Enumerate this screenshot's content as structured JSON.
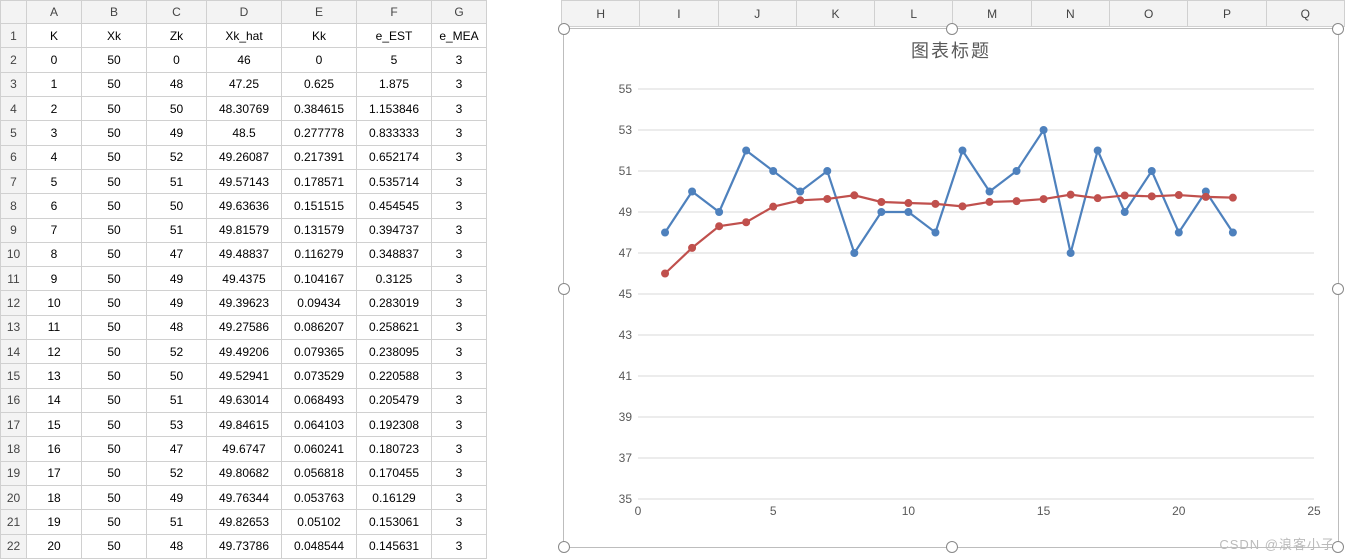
{
  "watermark": "CSDN @浪客小子",
  "columns": [
    "A",
    "B",
    "C",
    "D",
    "E",
    "F",
    "G",
    "H",
    "I",
    "J",
    "K",
    "L",
    "M",
    "N",
    "O",
    "P",
    "Q"
  ],
  "header_row": [
    "K",
    "Xk",
    "Zk",
    "Xk_hat",
    "Kk",
    "e_EST",
    "e_MEA"
  ],
  "rows": [
    {
      "r": "2",
      "A": "0",
      "B": "50",
      "C": "0",
      "D": "46",
      "E": "0",
      "F": "5",
      "G": "3"
    },
    {
      "r": "3",
      "A": "1",
      "B": "50",
      "C": "48",
      "D": "47.25",
      "E": "0.625",
      "F": "1.875",
      "G": "3"
    },
    {
      "r": "4",
      "A": "2",
      "B": "50",
      "C": "50",
      "D": "48.30769",
      "E": "0.384615",
      "F": "1.153846",
      "G": "3"
    },
    {
      "r": "5",
      "A": "3",
      "B": "50",
      "C": "49",
      "D": "48.5",
      "E": "0.277778",
      "F": "0.833333",
      "G": "3"
    },
    {
      "r": "6",
      "A": "4",
      "B": "50",
      "C": "52",
      "D": "49.26087",
      "E": "0.217391",
      "F": "0.652174",
      "G": "3"
    },
    {
      "r": "7",
      "A": "5",
      "B": "50",
      "C": "51",
      "D": "49.57143",
      "E": "0.178571",
      "F": "0.535714",
      "G": "3"
    },
    {
      "r": "8",
      "A": "6",
      "B": "50",
      "C": "50",
      "D": "49.63636",
      "E": "0.151515",
      "F": "0.454545",
      "G": "3"
    },
    {
      "r": "9",
      "A": "7",
      "B": "50",
      "C": "51",
      "D": "49.81579",
      "E": "0.131579",
      "F": "0.394737",
      "G": "3"
    },
    {
      "r": "10",
      "A": "8",
      "B": "50",
      "C": "47",
      "D": "49.48837",
      "E": "0.116279",
      "F": "0.348837",
      "G": "3"
    },
    {
      "r": "11",
      "A": "9",
      "B": "50",
      "C": "49",
      "D": "49.4375",
      "E": "0.104167",
      "F": "0.3125",
      "G": "3"
    },
    {
      "r": "12",
      "A": "10",
      "B": "50",
      "C": "49",
      "D": "49.39623",
      "E": "0.09434",
      "F": "0.283019",
      "G": "3"
    },
    {
      "r": "13",
      "A": "11",
      "B": "50",
      "C": "48",
      "D": "49.27586",
      "E": "0.086207",
      "F": "0.258621",
      "G": "3"
    },
    {
      "r": "14",
      "A": "12",
      "B": "50",
      "C": "52",
      "D": "49.49206",
      "E": "0.079365",
      "F": "0.238095",
      "G": "3"
    },
    {
      "r": "15",
      "A": "13",
      "B": "50",
      "C": "50",
      "D": "49.52941",
      "E": "0.073529",
      "F": "0.220588",
      "G": "3"
    },
    {
      "r": "16",
      "A": "14",
      "B": "50",
      "C": "51",
      "D": "49.63014",
      "E": "0.068493",
      "F": "0.205479",
      "G": "3"
    },
    {
      "r": "17",
      "A": "15",
      "B": "50",
      "C": "53",
      "D": "49.84615",
      "E": "0.064103",
      "F": "0.192308",
      "G": "3"
    },
    {
      "r": "18",
      "A": "16",
      "B": "50",
      "C": "47",
      "D": "49.6747",
      "E": "0.060241",
      "F": "0.180723",
      "G": "3"
    },
    {
      "r": "19",
      "A": "17",
      "B": "50",
      "C": "52",
      "D": "49.80682",
      "E": "0.056818",
      "F": "0.170455",
      "G": "3"
    },
    {
      "r": "20",
      "A": "18",
      "B": "50",
      "C": "49",
      "D": "49.76344",
      "E": "0.053763",
      "F": "0.16129",
      "G": "3"
    },
    {
      "r": "21",
      "A": "19",
      "B": "50",
      "C": "51",
      "D": "49.82653",
      "E": "0.05102",
      "F": "0.153061",
      "G": "3"
    },
    {
      "r": "22",
      "A": "20",
      "B": "50",
      "C": "48",
      "D": "49.73786",
      "E": "0.048544",
      "F": "0.145631",
      "G": "3"
    }
  ],
  "chart": {
    "title": "图表标题",
    "ylim": [
      35,
      55
    ],
    "yticks": [
      35,
      37,
      39,
      41,
      43,
      45,
      47,
      49,
      51,
      53,
      55
    ],
    "xlim": [
      0,
      25
    ],
    "xticks": [
      0,
      5,
      10,
      15,
      20,
      25
    ],
    "colors": {
      "blue": "#4e81bd",
      "red": "#c0504d"
    }
  },
  "chart_data": {
    "type": "line",
    "title": "图表标题",
    "xlabel": "",
    "ylabel": "",
    "xlim": [
      0,
      25
    ],
    "ylim": [
      35,
      55
    ],
    "x": [
      1,
      2,
      3,
      4,
      5,
      6,
      7,
      8,
      9,
      10,
      11,
      12,
      13,
      14,
      15,
      16,
      17,
      18,
      19,
      20,
      21,
      22
    ],
    "series": [
      {
        "name": "Zk",
        "color": "#4e81bd",
        "values": [
          48,
          50,
          49,
          52,
          51,
          50,
          51,
          47,
          49,
          49,
          48,
          52,
          50,
          51,
          53,
          47,
          52,
          49,
          51,
          48,
          50,
          48
        ]
      },
      {
        "name": "Xk_hat",
        "color": "#c0504d",
        "values": [
          46,
          47.25,
          48.30769,
          48.5,
          49.26087,
          49.57143,
          49.63636,
          49.81579,
          49.48837,
          49.4375,
          49.39623,
          49.27586,
          49.49206,
          49.52941,
          49.63014,
          49.84615,
          49.6747,
          49.80682,
          49.76344,
          49.82653,
          49.73786,
          49.7
        ]
      }
    ]
  }
}
